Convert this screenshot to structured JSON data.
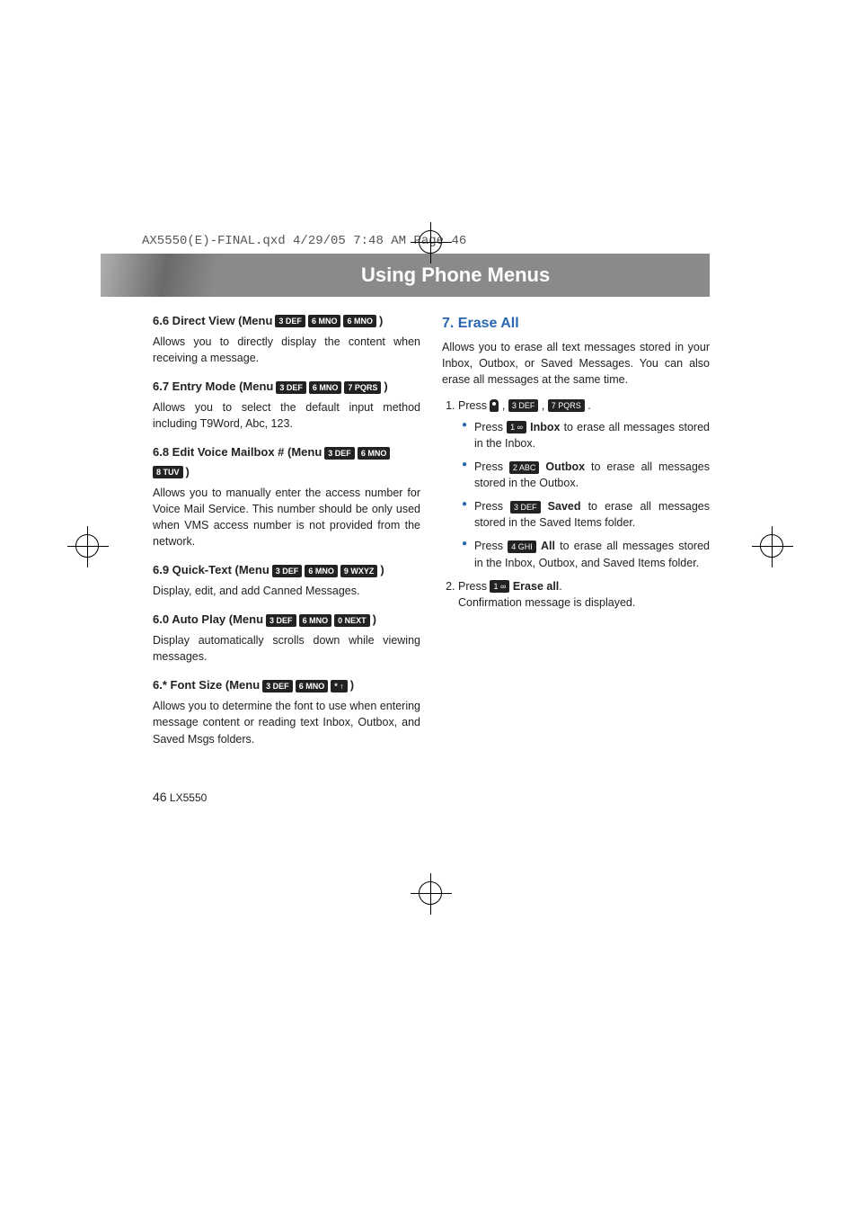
{
  "header_line": "AX5550(E)-FINAL.qxd  4/29/05  7:48 AM  Page 46",
  "banner_title": "Using Phone Menus",
  "left": {
    "s66": {
      "title_a": "6.6 Direct View (Menu",
      "k1": "3 DEF",
      "k2": "6 MNO",
      "k3": "6 MNO",
      "title_b": ")",
      "body": "Allows you to directly display the content when receiving a message."
    },
    "s67": {
      "title_a": "6.7 Entry Mode (Menu",
      "k1": "3 DEF",
      "k2": "6 MNO",
      "k3": "7 PQRS",
      "title_b": ")",
      "body": "Allows you to select the default input method including T9Word, Abc, 123."
    },
    "s68": {
      "title_a": "6.8 Edit Voice Mailbox # (Menu",
      "k1": "3 DEF",
      "k2": "6 MNO",
      "k3": "8 TUV",
      "title_b": ")",
      "body": "Allows you to manually enter the access number for Voice Mail Service. This number should be only used when VMS access number is not provided from the network."
    },
    "s69": {
      "title_a": "6.9 Quick-Text (Menu",
      "k1": "3 DEF",
      "k2": "6 MNO",
      "k3": "9 WXYZ",
      "title_b": ")",
      "body": "Display, edit, and add Canned Messages."
    },
    "s60": {
      "title_a": "6.0 Auto Play (Menu",
      "k1": "3 DEF",
      "k2": "6 MNO",
      "k3": "0 NEXT",
      "title_b": ")",
      "body": "Display automatically scrolls down while viewing messages."
    },
    "s6star": {
      "title_a": "6.* Font Size (Menu",
      "k1": "3 DEF",
      "k2": "6 MNO",
      "k3": "* ↑",
      "title_b": ")",
      "body": "Allows you to determine the font to use when entering message content or reading text Inbox, Outbox, and Saved Msgs folders."
    }
  },
  "right": {
    "title": "7. Erase All",
    "intro": "Allows you to erase all text messages stored in your Inbox, Outbox, or Saved Messages. You can also erase all messages at the same time.",
    "step1_a": "Press",
    "step1_k1": "3 DEF",
    "step1_k2": "7 PQRS",
    "step1_b": ".",
    "bul1_a": "Press",
    "bul1_key": "1 ∞",
    "bul1_b": "Inbox",
    "bul1_c": " to erase all messages stored in the Inbox.",
    "bul2_a": "Press",
    "bul2_key": "2 ABC",
    "bul2_b": "Outbox",
    "bul2_c": " to erase all messages stored in the Outbox.",
    "bul3_a": "Press",
    "bul3_key": "3 DEF",
    "bul3_b": "Saved",
    "bul3_c": " to erase all messages stored in the Saved Items folder.",
    "bul4_a": "Press",
    "bul4_key": "4 GHI",
    "bul4_b": "All",
    "bul4_c": " to erase all messages stored in the Inbox, Outbox, and Saved Items folder.",
    "step2_a": "Press",
    "step2_key": "1 ∞",
    "step2_b": "Erase all",
    "step2_c": ".",
    "step2_note": "Confirmation message is displayed."
  },
  "footer": {
    "page_num": "46",
    "model": "LX5550"
  },
  "chart_data": null
}
